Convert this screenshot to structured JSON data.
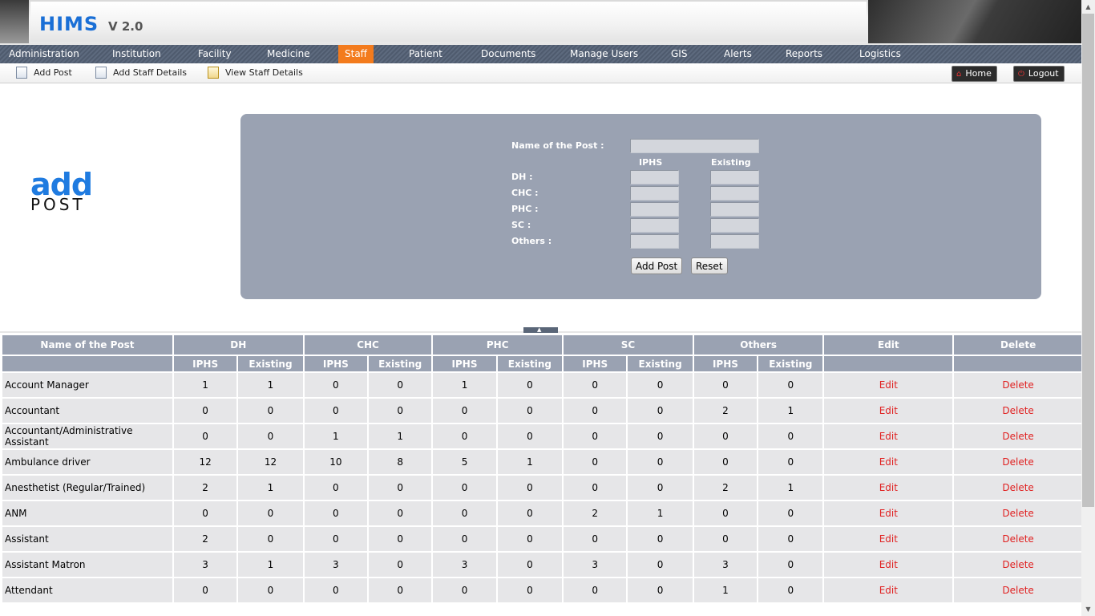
{
  "app": {
    "title": "HIMS",
    "version": "V 2.0"
  },
  "nav": {
    "items": [
      "Administration",
      "Institution",
      "Facility",
      "Medicine",
      "Staff",
      "Patient",
      "Documents",
      "Manage Users",
      "GIS",
      "Alerts",
      "Reports",
      "Logistics"
    ],
    "active": "Staff"
  },
  "subnav": {
    "add_post": "Add Post",
    "add_staff_details": "Add Staff Details",
    "view_staff_details": "View Staff Details",
    "home": "Home",
    "logout": "Logout"
  },
  "page_logo": {
    "line1": "add",
    "line2": "POST"
  },
  "form": {
    "name_label": "Name of the Post :",
    "col_iphs": "IPHS",
    "col_existing": "Existing",
    "rows": [
      "DH :",
      "CHC :",
      "PHC :",
      "SC :",
      "Others :"
    ],
    "add_button": "Add Post",
    "reset_button": "Reset"
  },
  "table": {
    "headers": [
      "Name of the Post",
      "DH",
      "CHC",
      "PHC",
      "SC",
      "Others",
      "Edit",
      "Delete"
    ],
    "subheaders": [
      "IPHS",
      "Existing"
    ],
    "rows": [
      {
        "name": "Account Manager",
        "values": [
          "1",
          "1",
          "0",
          "0",
          "1",
          "0",
          "0",
          "0",
          "0",
          "0"
        ]
      },
      {
        "name": "Accountant",
        "values": [
          "0",
          "0",
          "0",
          "0",
          "0",
          "0",
          "0",
          "0",
          "2",
          "1"
        ]
      },
      {
        "name": "Accountant/Administrative Assistant",
        "values": [
          "0",
          "0",
          "1",
          "1",
          "0",
          "0",
          "0",
          "0",
          "0",
          "0"
        ]
      },
      {
        "name": "Ambulance driver",
        "values": [
          "12",
          "12",
          "10",
          "8",
          "5",
          "1",
          "0",
          "0",
          "0",
          "0"
        ]
      },
      {
        "name": "Anesthetist (Regular/Trained)",
        "values": [
          "2",
          "1",
          "0",
          "0",
          "0",
          "0",
          "0",
          "0",
          "2",
          "1"
        ]
      },
      {
        "name": "ANM",
        "values": [
          "0",
          "0",
          "0",
          "0",
          "0",
          "0",
          "2",
          "1",
          "0",
          "0"
        ]
      },
      {
        "name": "Assistant",
        "values": [
          "2",
          "0",
          "0",
          "0",
          "0",
          "0",
          "0",
          "0",
          "0",
          "0"
        ]
      },
      {
        "name": "Assistant Matron",
        "values": [
          "3",
          "1",
          "3",
          "0",
          "3",
          "0",
          "3",
          "0",
          "3",
          "0"
        ]
      },
      {
        "name": "Attendant",
        "values": [
          "0",
          "0",
          "0",
          "0",
          "0",
          "0",
          "0",
          "0",
          "1",
          "0"
        ]
      }
    ],
    "edit_label": "Edit",
    "delete_label": "Delete"
  }
}
